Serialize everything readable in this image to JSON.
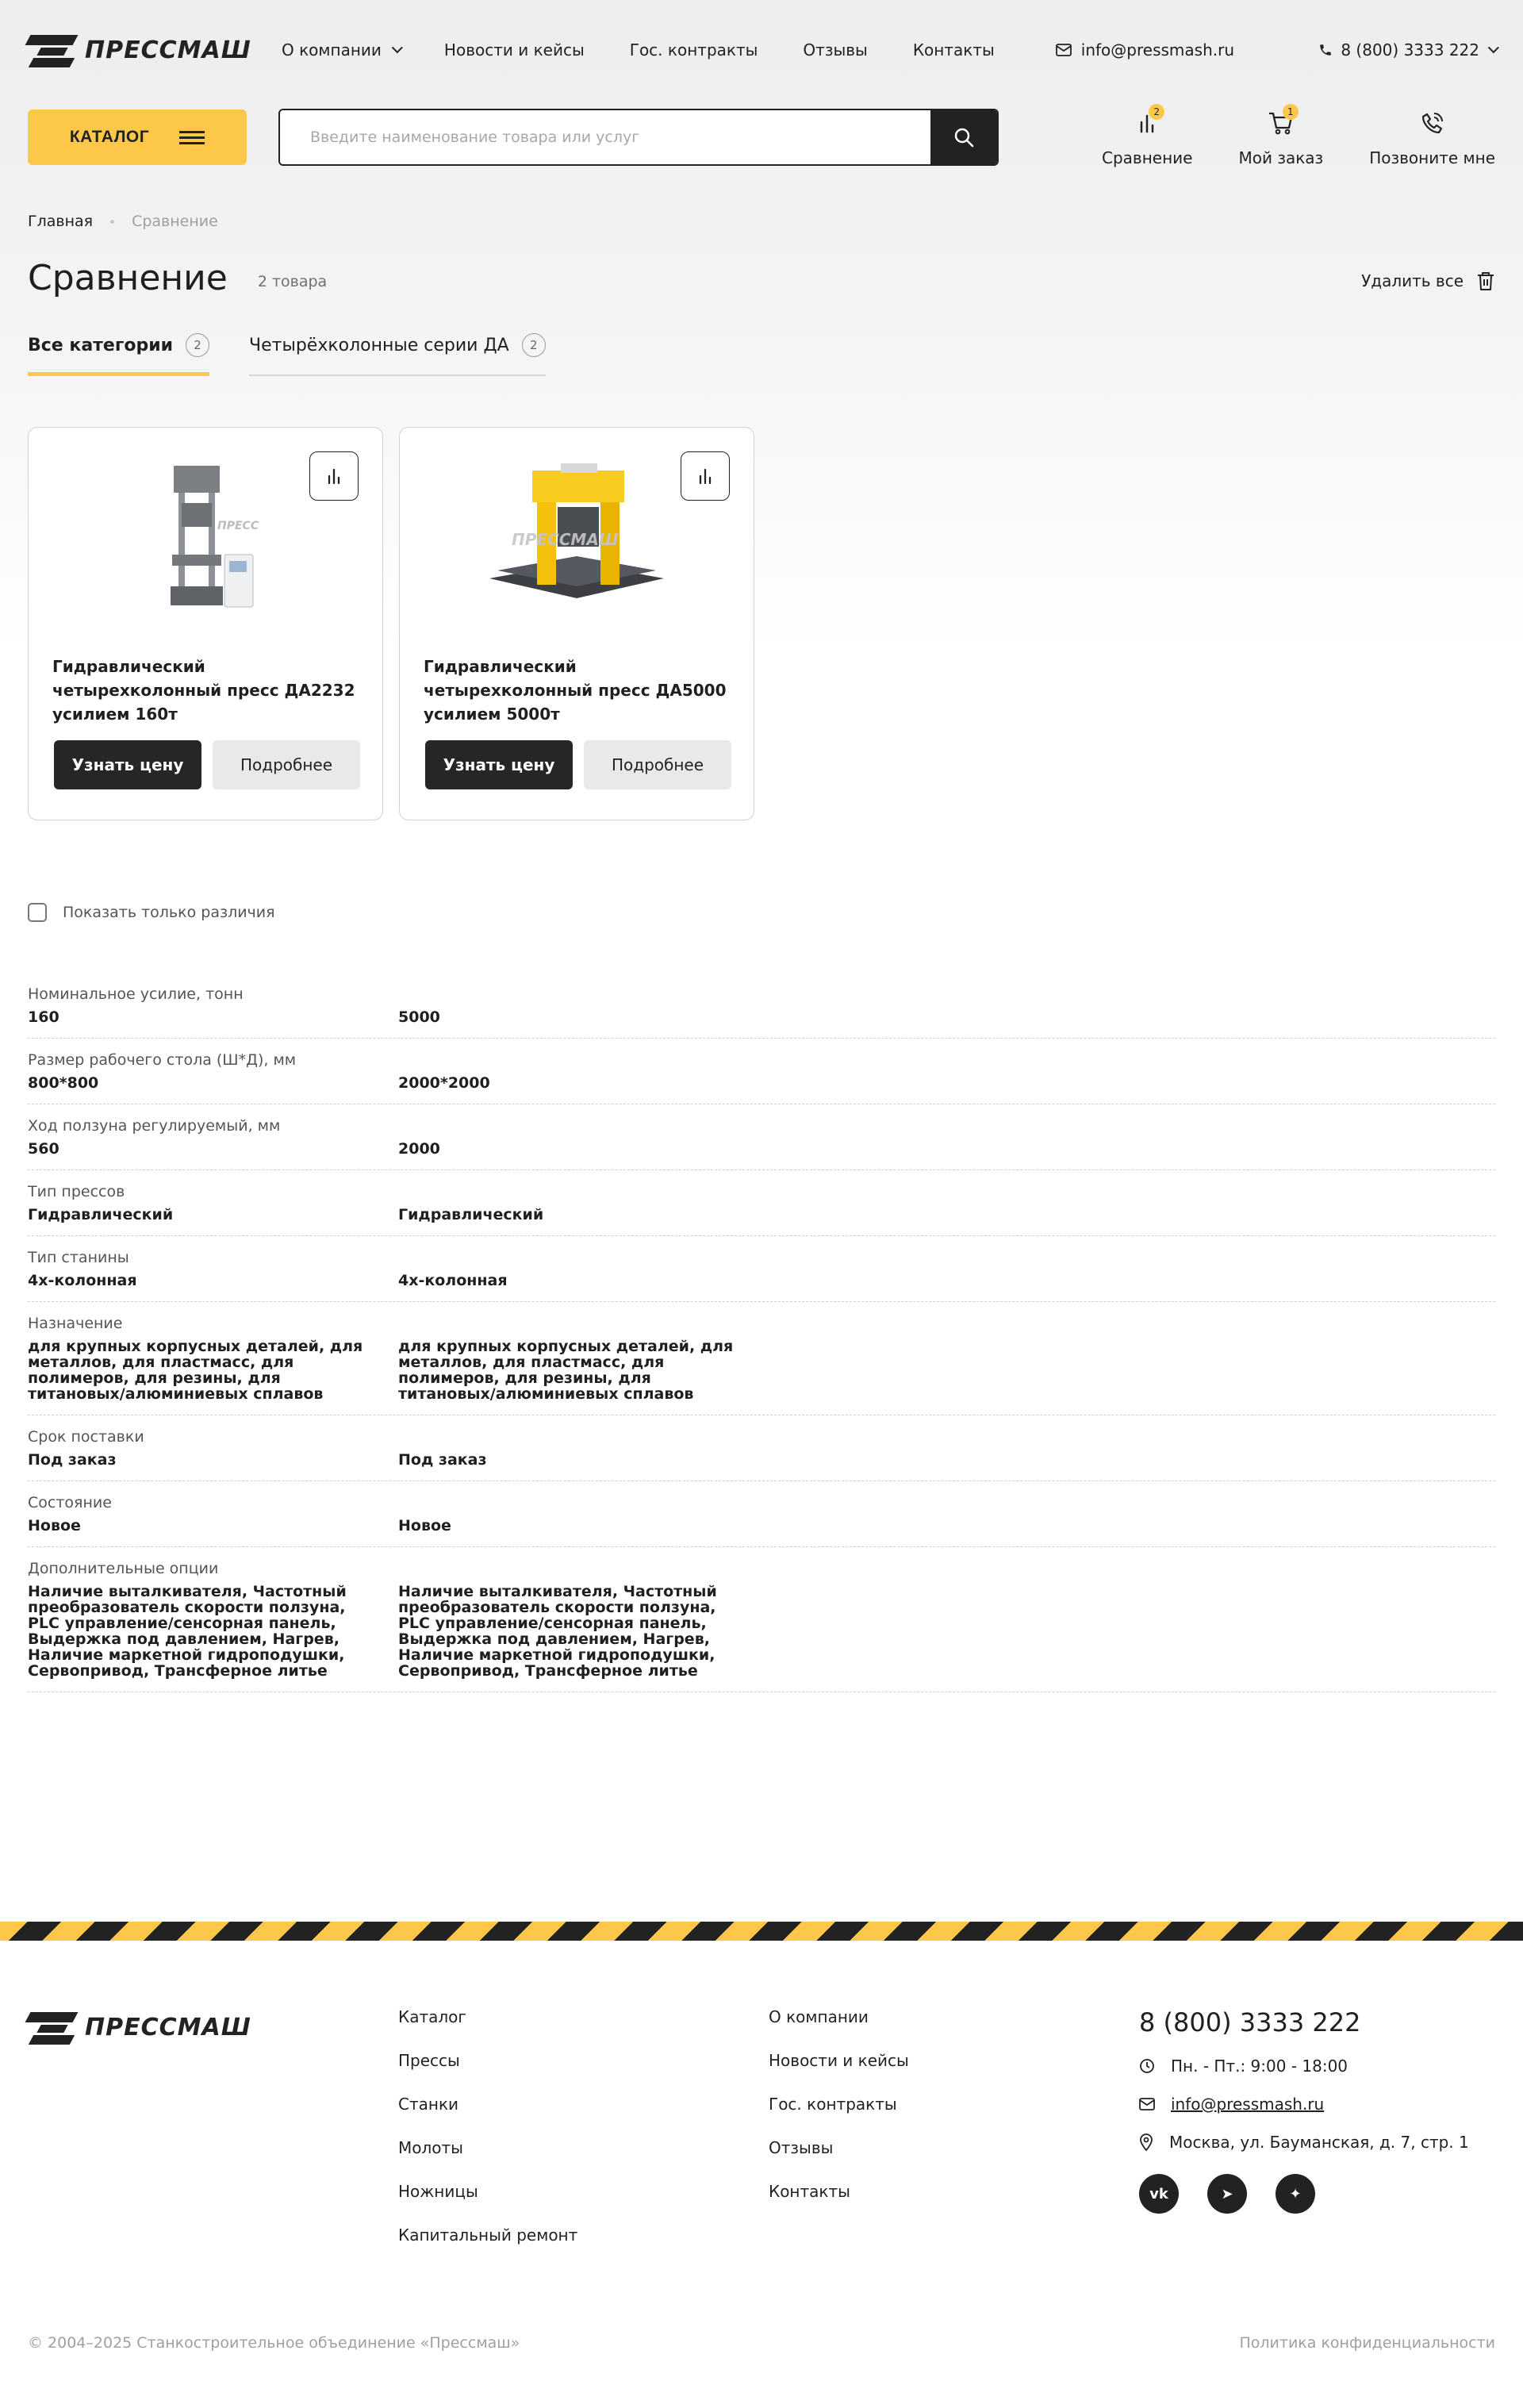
{
  "header": {
    "logo_text": "ПРЕССМАШ",
    "nav": [
      {
        "label": "О компании"
      },
      {
        "label": "Новости и кейсы"
      },
      {
        "label": "Гос. контракты"
      },
      {
        "label": "Отзывы"
      },
      {
        "label": "Контакты"
      }
    ],
    "email": "info@pressmash.ru",
    "phone": "8 (800) 3333 222",
    "catalog_label": "КАТАЛОГ",
    "search_placeholder": "Введите наименование товара или услуг",
    "actions": [
      {
        "label": "Сравнение",
        "badge": "2",
        "icon": "compare-icon"
      },
      {
        "label": "Мой заказ",
        "badge": "1",
        "icon": "cart-icon"
      },
      {
        "label": "Позвоните мне",
        "badge": "",
        "icon": "phone-call-icon"
      }
    ]
  },
  "breadcrumb": {
    "home": "Главная",
    "current": "Сравнение"
  },
  "page": {
    "title": "Сравнение",
    "count": "2 товара",
    "delete_all": "Удалить все"
  },
  "tabs": [
    {
      "label": "Все категории",
      "count": "2"
    },
    {
      "label": "Четырёхколонные серии ДА",
      "count": "2"
    }
  ],
  "products": [
    {
      "name": "Гидравлический четырехколонный пресс ДА2232 усилием 160т",
      "price_btn": "Узнать цену",
      "more_btn": "Подробнее",
      "image_style": "gray"
    },
    {
      "name": "Гидравлический четырехколонный пресс ДА5000 усилием 5000т",
      "price_btn": "Узнать цену",
      "more_btn": "Подробнее",
      "image_style": "yellow"
    }
  ],
  "diff_toggle": "Показать только различия",
  "specs": [
    {
      "label": "Номинальное усилие, тонн",
      "values": [
        "160",
        "5000"
      ]
    },
    {
      "label": "Размер рабочего стола (Ш*Д), мм",
      "values": [
        "800*800",
        "2000*2000"
      ]
    },
    {
      "label": "Ход ползуна регулируемый, мм",
      "values": [
        "560",
        "2000"
      ]
    },
    {
      "label": "Тип прессов",
      "values": [
        "Гидравлический",
        "Гидравлический"
      ]
    },
    {
      "label": "Тип станины",
      "values": [
        "4х-колонная",
        "4х-колонная"
      ]
    },
    {
      "label": "Назначение",
      "values": [
        "для крупных корпусных деталей, для металлов, для пластмасс, для полимеров, для резины, для титановых/алюминиевых сплавов",
        "для крупных корпусных деталей, для металлов, для пластмасс, для полимеров, для резины, для титановых/алюминиевых сплавов"
      ]
    },
    {
      "label": "Срок поставки",
      "values": [
        "Под заказ",
        "Под заказ"
      ]
    },
    {
      "label": "Состояние",
      "values": [
        "Новое",
        "Новое"
      ]
    },
    {
      "label": "Дополнительные опции",
      "values": [
        "Наличие выталкивателя, Частотный преобразователь скорости ползуна, PLC управление/сенсорная панель, Выдержка под давлением, Нагрев, Наличие маркетной гидроподушки, Сервопривод, Трансферное литье",
        "Наличие выталкивателя, Частотный преобразователь скорости ползуна, PLC управление/сенсорная панель, Выдержка под давлением, Нагрев, Наличие маркетной гидроподушки, Сервопривод, Трансферное литье"
      ]
    }
  ],
  "footer": {
    "catalog_links": [
      "Каталог",
      "Прессы",
      "Станки",
      "Молоты",
      "Ножницы",
      "Капитальный ремонт"
    ],
    "company_links": [
      "О компании",
      "Новости и кейсы",
      "Гос. контракты",
      "Отзывы",
      "Контакты"
    ],
    "phone": "8 (800) 3333 222",
    "hours": "Пн. - Пт.: 9:00 - 18:00",
    "email": "info@pressmash.ru",
    "address": "Москва, ул. Бауманская, д. 7, стр. 1",
    "socials": [
      {
        "name": "vk",
        "glyph": "vk"
      },
      {
        "name": "telegram",
        "glyph": "➤"
      },
      {
        "name": "dzen",
        "glyph": "✦"
      }
    ],
    "copyright": "© 2004–2025 Станкостроительное объединение «Прессмаш»",
    "privacy": "Политика конфиденциальности"
  },
  "colors": {
    "accent": "#fdc84a",
    "dark": "#222222"
  }
}
